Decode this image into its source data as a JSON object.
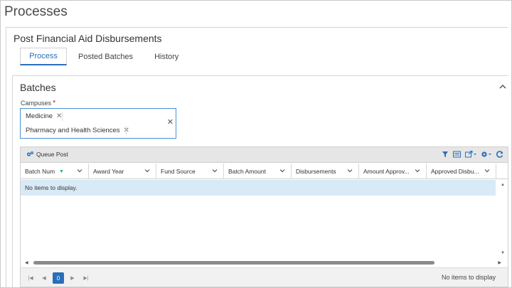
{
  "page": {
    "title": "Processes"
  },
  "panel": {
    "title": "Post Financial Aid Disbursements",
    "tabs": [
      {
        "label": "Process",
        "active": true
      },
      {
        "label": "Posted Batches",
        "active": false
      },
      {
        "label": "History",
        "active": false
      }
    ]
  },
  "batches": {
    "title": "Batches",
    "campuses_label": "Campuses",
    "required_mark": "*",
    "selected_campuses": [
      "Medicine",
      "Pharmacy and Health Sciences"
    ]
  },
  "grid": {
    "toolbar": {
      "queue_post_label": "Queue Post"
    },
    "columns": [
      "Batch Num",
      "Award Year",
      "Fund Source",
      "Batch Amount",
      "Disbursements",
      "Amount Approv...",
      "Approved Disbu..."
    ],
    "empty_message": "No items to display.",
    "pager": {
      "current_page": "0",
      "status": "No items to display"
    }
  },
  "colors": {
    "accent": "#2a6ebb",
    "required": "#d9262c",
    "selected_row": "#d9eaf7",
    "toolbar_bg": "#e6e6e6",
    "sort_indicator": "#2aa39a"
  }
}
